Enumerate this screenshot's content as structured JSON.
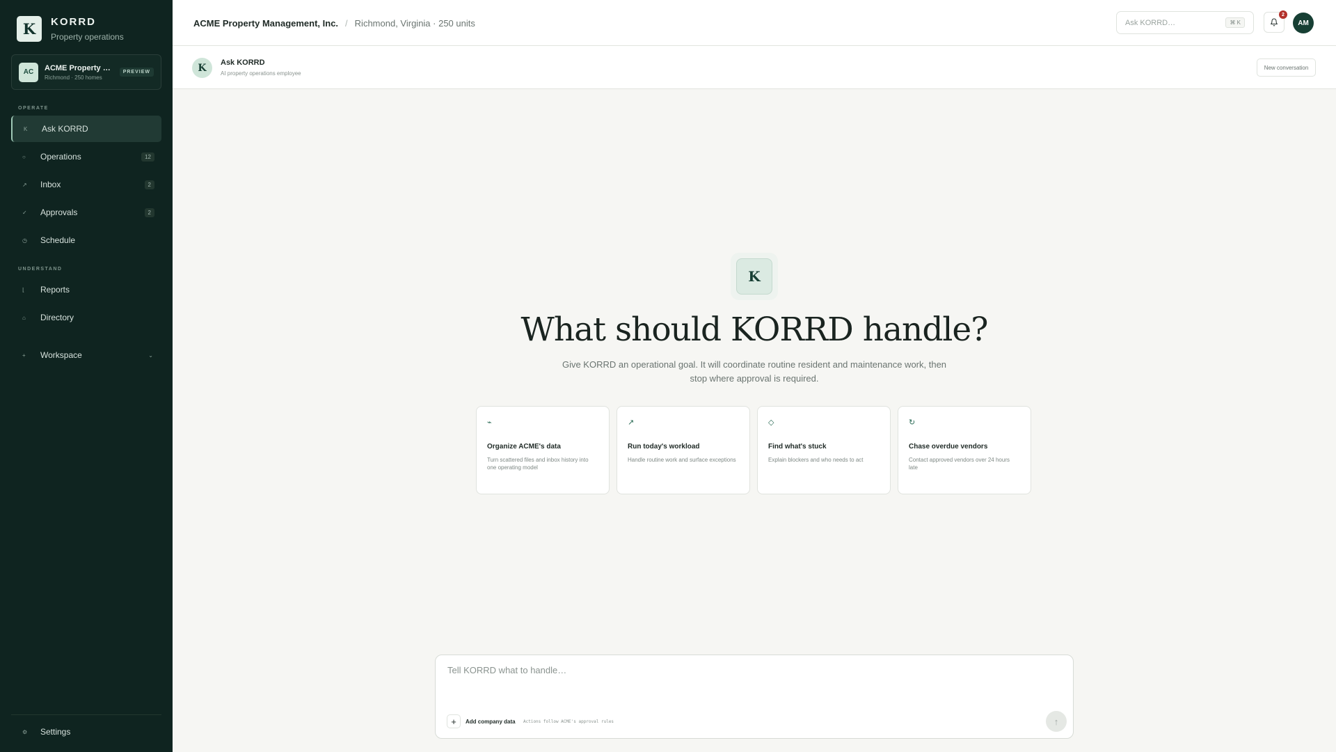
{
  "brand": {
    "logo_letter": "K",
    "name": "KORRD",
    "subtitle": "Property operations"
  },
  "org_card": {
    "initials": "AC",
    "name": "ACME Property Ma…",
    "meta": "Richmond · 250 homes",
    "badge": "PREVIEW"
  },
  "sidebar": {
    "section_operate": "OPERATE",
    "section_understand": "UNDERSTAND",
    "items": [
      {
        "label": "Ask KORRD",
        "icon": "K",
        "count": "",
        "active": true
      },
      {
        "label": "Operations",
        "icon": "○",
        "count": "12"
      },
      {
        "label": "Inbox",
        "icon": "↗",
        "count": "2"
      },
      {
        "label": "Approvals",
        "icon": "✓",
        "count": "2"
      },
      {
        "label": "Schedule",
        "icon": "◷",
        "count": ""
      },
      {
        "label": "Reports",
        "icon": "⌊",
        "count": ""
      },
      {
        "label": "Directory",
        "icon": "⌂",
        "count": ""
      },
      {
        "label": "Workspace",
        "icon": "+",
        "count": ""
      }
    ],
    "settings": {
      "label": "Settings",
      "icon": "⚙"
    }
  },
  "header": {
    "org_name": "ACME Property Management, Inc.",
    "separator": "/",
    "location": "Richmond, Virginia · 250 units",
    "search_placeholder": "Ask KORRD…",
    "search_shortcut": "⌘ K",
    "notification_count": "2",
    "user_initials": "AM"
  },
  "conversation": {
    "avatar_letter": "K",
    "title": "Ask KORRD",
    "subtitle": "AI property operations employee",
    "new_button": "New conversation"
  },
  "hero": {
    "logo_letter": "K",
    "title": "What should KORRD handle?",
    "description": "Give KORRD an operational goal. It will coordinate routine resident and maintenance work, then stop where approval is required."
  },
  "cards": [
    {
      "icon": "⌁",
      "title": "Organize ACME's data",
      "desc": "Turn scattered files and inbox history into one operating model"
    },
    {
      "icon": "↗",
      "title": "Run today's workload",
      "desc": "Handle routine work and surface exceptions"
    },
    {
      "icon": "◇",
      "title": "Find what's stuck",
      "desc": "Explain blockers and who needs to act"
    },
    {
      "icon": "↻",
      "title": "Chase overdue vendors",
      "desc": "Contact approved vendors over 24 hours late"
    }
  ],
  "composer": {
    "placeholder": "Tell KORRD what to handle…",
    "add_icon": "+",
    "add_label": "Add company data",
    "note": "Actions follow ACME's approval rules",
    "send_icon": "↑"
  },
  "colors": {
    "sidebar_bg": "#0f2420",
    "accent": "#173f34",
    "badge_red": "#b3312b",
    "page_bg": "#f6f6f3"
  }
}
